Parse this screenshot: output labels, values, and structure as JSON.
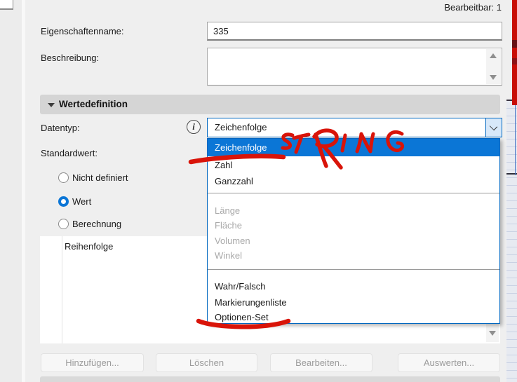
{
  "header": {
    "editable_label": "Bearbeitbar: 1"
  },
  "fields": {
    "name_label": "Eigenschaftenname:",
    "name_value": "335",
    "description_label": "Beschreibung:",
    "description_value": ""
  },
  "section": {
    "title": "Wertedefinition"
  },
  "datatype": {
    "label": "Datentyp:",
    "info_icon_glyph": "i",
    "selected_value": "Zeichenfolge"
  },
  "dropdown": {
    "options": [
      {
        "label": "Zeichenfolge",
        "state": "selected"
      },
      {
        "label": "Zahl",
        "state": "normal"
      },
      {
        "label": "Ganzzahl",
        "state": "normal"
      },
      {
        "label": "Länge",
        "state": "disabled"
      },
      {
        "label": "Fläche",
        "state": "disabled"
      },
      {
        "label": "Volumen",
        "state": "disabled"
      },
      {
        "label": "Winkel",
        "state": "disabled"
      },
      {
        "label": "Wahr/Falsch",
        "state": "normal"
      },
      {
        "label": "Markierungenliste",
        "state": "normal"
      },
      {
        "label": "Optionen-Set",
        "state": "normal"
      }
    ],
    "highlight_color": "#0b76d6"
  },
  "standard": {
    "label": "Standardwert:",
    "options": [
      {
        "label": "Nicht definiert",
        "selected": false
      },
      {
        "label": "Wert",
        "selected": true
      },
      {
        "label": "Berechnung",
        "selected": false
      }
    ]
  },
  "list": {
    "column_header": "Reihenfolge"
  },
  "buttons": [
    {
      "label": "Hinzufügen..."
    },
    {
      "label": "Löschen"
    },
    {
      "label": "Bearbeiten..."
    },
    {
      "label": "Auswerten..."
    }
  ],
  "annotations": {
    "string_text": "STRING",
    "pen_color": "#d91409"
  }
}
